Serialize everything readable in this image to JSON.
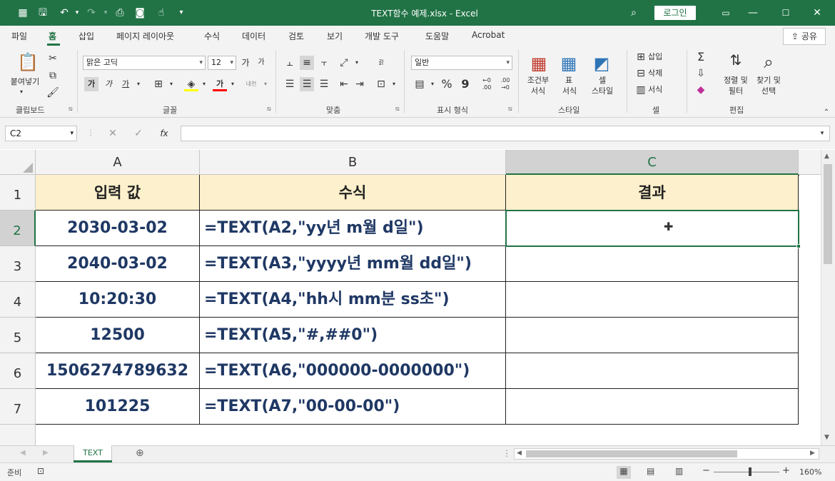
{
  "titlebar": {
    "title": "TEXT함수 예제.xlsx  -  Excel",
    "login": "로그인",
    "icons": [
      "autosave-icon",
      "save-icon",
      "undo-icon",
      "redo-icon",
      "print-preview-icon",
      "camera-icon",
      "touch-mode-icon",
      "customize-qat-icon"
    ]
  },
  "tabs": [
    "파일",
    "홈",
    "삽입",
    "페이지 레이아웃",
    "수식",
    "데이터",
    "검토",
    "보기",
    "개발 도구",
    "도움말",
    "Acrobat"
  ],
  "share": "공유",
  "ribbon": {
    "clipboard": {
      "paste": "붙여넣기",
      "label": "클립보드"
    },
    "font": {
      "name": "맑은 고딕",
      "size": "12",
      "bold": "가",
      "italic": "가",
      "underline": "가",
      "color": "가",
      "phonetic": "내천",
      "grow": "가",
      "shrink": "가",
      "label": "글꼴"
    },
    "alignment": {
      "label": "맞춤",
      "wrap": "갉"
    },
    "number": {
      "format": "일반",
      "percent": "%",
      "comma": "9",
      "inc": "←0 .00",
      "dec": ".00 →0",
      "label": "표시 형식"
    },
    "styles": {
      "conditional": "조건부",
      "conditional2": "서식",
      "table": "표",
      "table2": "서식",
      "cell": "셀",
      "cell2": "스타일",
      "label": "스타일"
    },
    "cells": {
      "insert": "삽입",
      "delete": "삭제",
      "format": "서식",
      "label": "셀"
    },
    "editing": {
      "sum": "Σ",
      "sort": "정렬 및",
      "sort2": "필터",
      "find": "찾기 및",
      "find2": "선택",
      "label": "편집"
    }
  },
  "formula_bar": {
    "namebox": "C2",
    "cancel": "✕",
    "enter": "✓",
    "fx": "fx",
    "formula": ""
  },
  "columns": [
    "A",
    "B",
    "C"
  ],
  "rows": [
    "1",
    "2",
    "3",
    "4",
    "5",
    "6",
    "7"
  ],
  "table": {
    "header": [
      "입력 값",
      "수식",
      "결과"
    ],
    "body": [
      [
        "2030-03-02",
        "=TEXT(A2,\"yy년 m월 d일\")",
        ""
      ],
      [
        "2040-03-02",
        "=TEXT(A3,\"yyyy년 mm월 dd일\")",
        ""
      ],
      [
        "10:20:30",
        "=TEXT(A4,\"hh시 mm분 ss초\")",
        ""
      ],
      [
        "12500",
        "=TEXT(A5,\"#,##0\")",
        ""
      ],
      [
        "1506274789632",
        "=TEXT(A6,\"000000-0000000\")",
        ""
      ],
      [
        "101225",
        "=TEXT(A7,\"00-00-00\")",
        ""
      ]
    ]
  },
  "sheet": {
    "tab": "TEXT"
  },
  "status": {
    "ready": "준비",
    "zoom": "160%"
  },
  "colors": {
    "accent": "#217346",
    "header_fill": "#fdf0cc",
    "text": "#1f3864"
  }
}
